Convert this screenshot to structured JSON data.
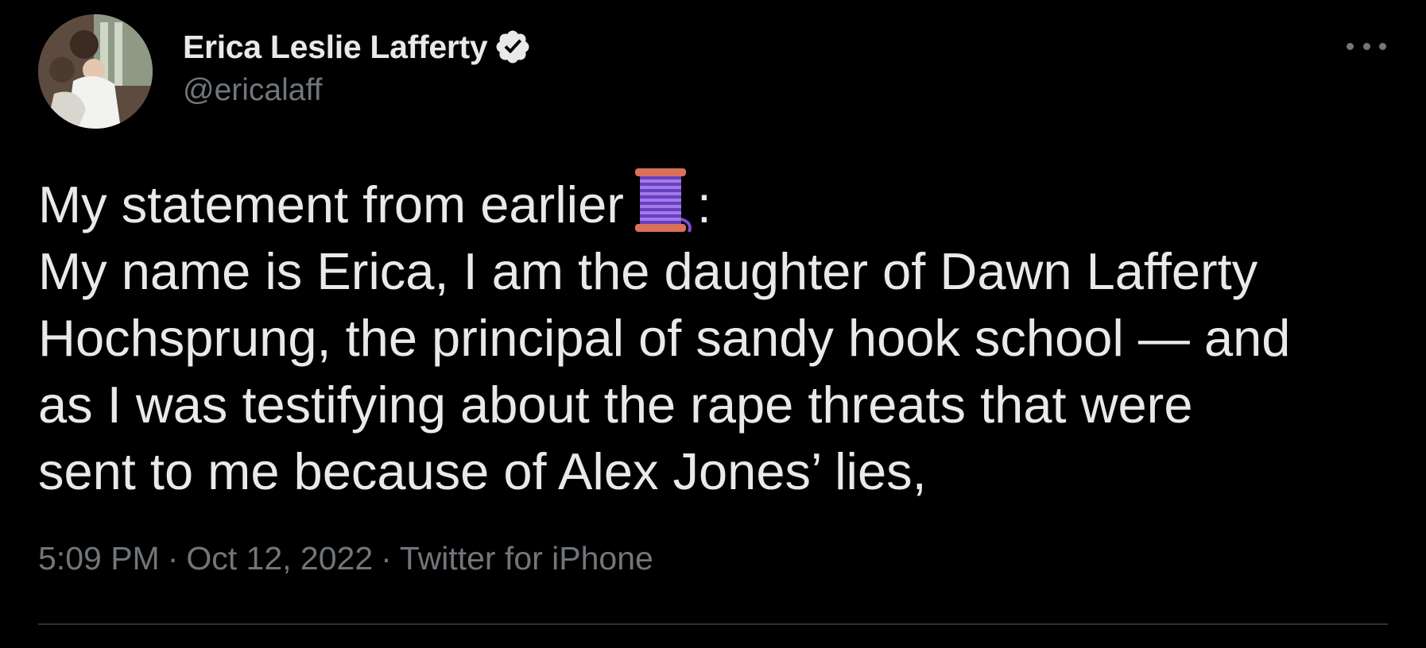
{
  "author": {
    "display_name": "Erica Leslie Lafferty",
    "handle": "@ericalaff",
    "verified_icon": "verified-badge-icon"
  },
  "tweet": {
    "lines": [
      "My statement from earlier",
      ":",
      "My name is Erica, I am the daughter of Dawn Lafferty",
      "Hochsprung, the principal of sandy hook school — and",
      "as I was testifying about the rape threats that were",
      "sent to me because of Alex Jones’ lies,"
    ],
    "emoji_icon": "thread-spool-icon"
  },
  "meta": {
    "time": "5:09 PM",
    "date": "Oct 12, 2022",
    "separator": "·",
    "source": "Twitter for iPhone"
  },
  "colors": {
    "background": "#000000",
    "text": "#e7e9ea",
    "secondary": "#71767b",
    "divider": "#2f3336"
  }
}
